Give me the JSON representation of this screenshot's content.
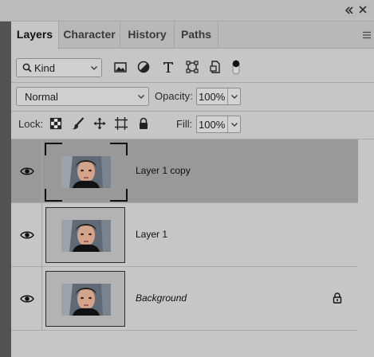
{
  "window": {
    "collapse_glyph": "«",
    "close_glyph": "✕"
  },
  "tabs": [
    {
      "label": "Layers",
      "active": true
    },
    {
      "label": "Character",
      "active": false
    },
    {
      "label": "History",
      "active": false
    },
    {
      "label": "Paths",
      "active": false
    }
  ],
  "filter": {
    "kind_label": "Kind",
    "buttons": [
      "image-filter-icon",
      "adjustment-filter-icon",
      "type-filter-icon",
      "shape-filter-icon",
      "smart-object-filter-icon",
      "filter-toggle-icon"
    ]
  },
  "blend": {
    "mode": "Normal",
    "opacity_label": "Opacity:",
    "opacity_value": "100%"
  },
  "lock": {
    "label": "Lock:",
    "buttons": [
      "lock-transparent-pixels-icon",
      "lock-image-pixels-icon",
      "lock-position-icon",
      "lock-artboard-icon",
      "lock-all-icon"
    ],
    "fill_label": "Fill:",
    "fill_value": "100%"
  },
  "layers": [
    {
      "name": "Layer 1 copy",
      "selected": true,
      "visible": true,
      "locked": false,
      "italic": false
    },
    {
      "name": "Layer 1",
      "selected": false,
      "visible": true,
      "locked": false,
      "italic": false
    },
    {
      "name": "Background",
      "selected": false,
      "visible": true,
      "locked": true,
      "italic": true
    }
  ],
  "colors": {
    "panel": "#c6c6c6",
    "selected_row": "#999999",
    "tab_bar": "#b8b8b8"
  }
}
